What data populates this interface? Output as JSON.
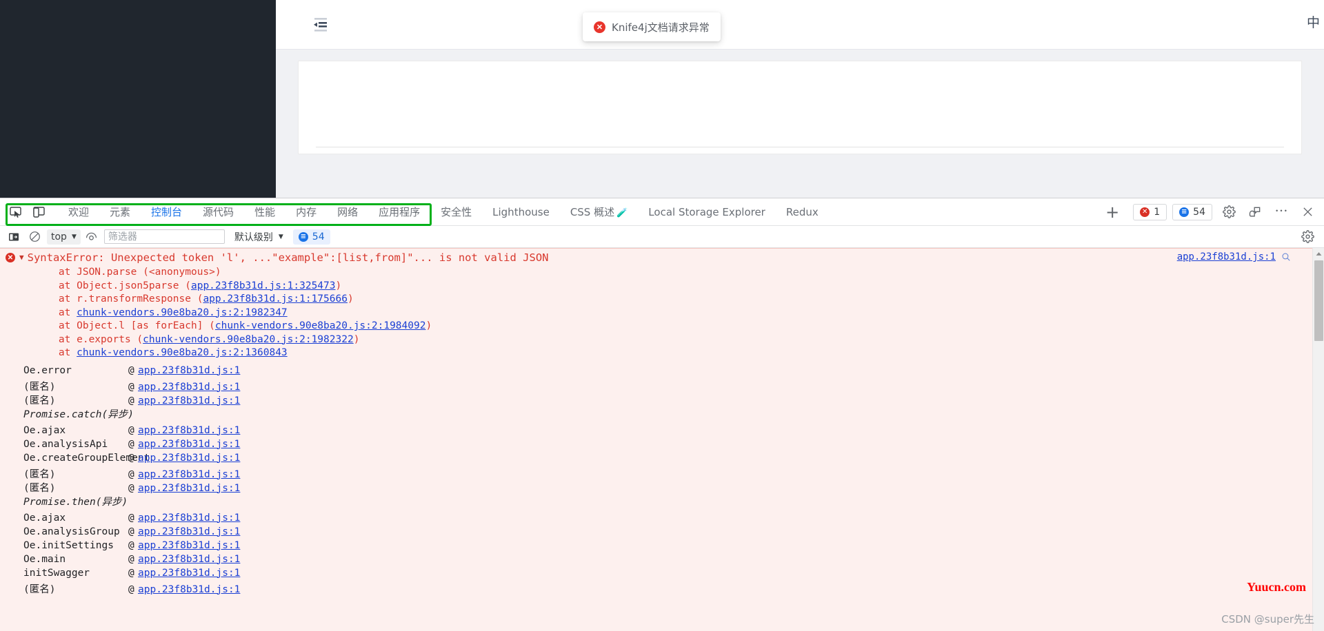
{
  "page": {
    "menu_fold_icon": "menu-fold-icon",
    "lang_switch": "中",
    "toast": {
      "icon": "error-circle-icon",
      "icon_glyph": "✕",
      "message": "Knife4j文档请求异常"
    }
  },
  "devtools": {
    "dock_icons": [
      "inspect-element-icon",
      "device-toolbar-icon"
    ],
    "tabs": [
      {
        "label": "欢迎",
        "selected": false
      },
      {
        "label": "元素",
        "selected": false
      },
      {
        "label": "控制台",
        "selected": true
      },
      {
        "label": "源代码",
        "selected": false
      },
      {
        "label": "性能",
        "selected": false
      },
      {
        "label": "内存",
        "selected": false
      },
      {
        "label": "网络",
        "selected": false
      },
      {
        "label": "应用程序",
        "selected": false
      },
      {
        "label": "安全性",
        "selected": false
      },
      {
        "label": "Lighthouse",
        "selected": false
      },
      {
        "label": "CSS 概述",
        "selected": false,
        "badge": "🧪"
      },
      {
        "label": "Local Storage Explorer",
        "selected": false
      },
      {
        "label": "Redux",
        "selected": false
      }
    ],
    "add_tab_label": "+",
    "error_count": "1",
    "message_count": "54",
    "right_icons": [
      "settings-gear-icon",
      "customize-devtools-icon",
      "more-options-icon",
      "close-devtools-icon"
    ],
    "icon_glyphs": {
      "more": "⋯",
      "close": "✕"
    }
  },
  "console_toolbar": {
    "sidebar_toggle_icon": "console-sidebar-icon",
    "clear_icon": "clear-console-icon",
    "context_selector": "top",
    "eye_icon": "live-expression-icon",
    "filter_placeholder": "筛选器",
    "filter_value": "",
    "level_selector": "默认级别",
    "message_chip": "54",
    "settings_icon": "console-settings-icon",
    "caret_glyph": "▼"
  },
  "console": {
    "error": {
      "icon": "error-circle-icon",
      "disclosure": "▼",
      "text": "SyntaxError: Unexpected token 'l', ...\"example\":[list,from]\"... is not valid JSON",
      "source_link": "app.23f8b31d.js:1",
      "source_search_icon": "search-in-source-icon",
      "highlight_color": "#00b019"
    },
    "stack_lines": [
      {
        "prefix": "    at JSON.parse (<anonymous>)",
        "link": "",
        "suffix": ""
      },
      {
        "prefix": "    at Object.json5parse (",
        "link": "app.23f8b31d.js:1:325473",
        "suffix": ")"
      },
      {
        "prefix": "    at r.transformResponse (",
        "link": "app.23f8b31d.js:1:175666",
        "suffix": ")"
      },
      {
        "prefix": "    at ",
        "link": "chunk-vendors.90e8ba20.js:2:1982347",
        "suffix": ""
      },
      {
        "prefix": "    at Object.l [as forEach] (",
        "link": "chunk-vendors.90e8ba20.js:2:1984092",
        "suffix": ")"
      },
      {
        "prefix": "    at e.exports (",
        "link": "chunk-vendors.90e8ba20.js:2:1982322",
        "suffix": ")"
      },
      {
        "prefix": "    at ",
        "link": "chunk-vendors.90e8ba20.js:2:1360843",
        "suffix": ""
      }
    ],
    "frames": [
      {
        "type": "frame",
        "name": "Oe.error",
        "at": "@",
        "link": "app.23f8b31d.js:1"
      },
      {
        "type": "frame",
        "name": "(匿名)",
        "at": "@",
        "link": "app.23f8b31d.js:1"
      },
      {
        "type": "frame",
        "name": "(匿名)",
        "at": "@",
        "link": "app.23f8b31d.js:1"
      },
      {
        "type": "async",
        "name": "Promise.catch(异步)"
      },
      {
        "type": "frame",
        "name": "Oe.ajax",
        "at": "@",
        "link": "app.23f8b31d.js:1"
      },
      {
        "type": "frame",
        "name": "Oe.analysisApi",
        "at": "@",
        "link": "app.23f8b31d.js:1"
      },
      {
        "type": "frame",
        "name": "Oe.createGroupElement",
        "at": "@",
        "link": "app.23f8b31d.js:1"
      },
      {
        "type": "frame",
        "name": "(匿名)",
        "at": "@",
        "link": "app.23f8b31d.js:1"
      },
      {
        "type": "frame",
        "name": "(匿名)",
        "at": "@",
        "link": "app.23f8b31d.js:1"
      },
      {
        "type": "async",
        "name": "Promise.then(异步)"
      },
      {
        "type": "frame",
        "name": "Oe.ajax",
        "at": "@",
        "link": "app.23f8b31d.js:1"
      },
      {
        "type": "frame",
        "name": "Oe.analysisGroup",
        "at": "@",
        "link": "app.23f8b31d.js:1"
      },
      {
        "type": "frame",
        "name": "Oe.initSettings",
        "at": "@",
        "link": "app.23f8b31d.js:1"
      },
      {
        "type": "frame",
        "name": "Oe.main",
        "at": "@",
        "link": "app.23f8b31d.js:1"
      },
      {
        "type": "frame",
        "name": "initSwagger",
        "at": "@",
        "link": "app.23f8b31d.js:1"
      },
      {
        "type": "frame",
        "name": "(匿名)",
        "at": "@",
        "link": "app.23f8b31d.js:1"
      }
    ],
    "scrollbar": {
      "up_arrow": "▲"
    }
  },
  "watermarks": {
    "primary": "Yuucn.com",
    "secondary": "CSDN @super先生"
  }
}
